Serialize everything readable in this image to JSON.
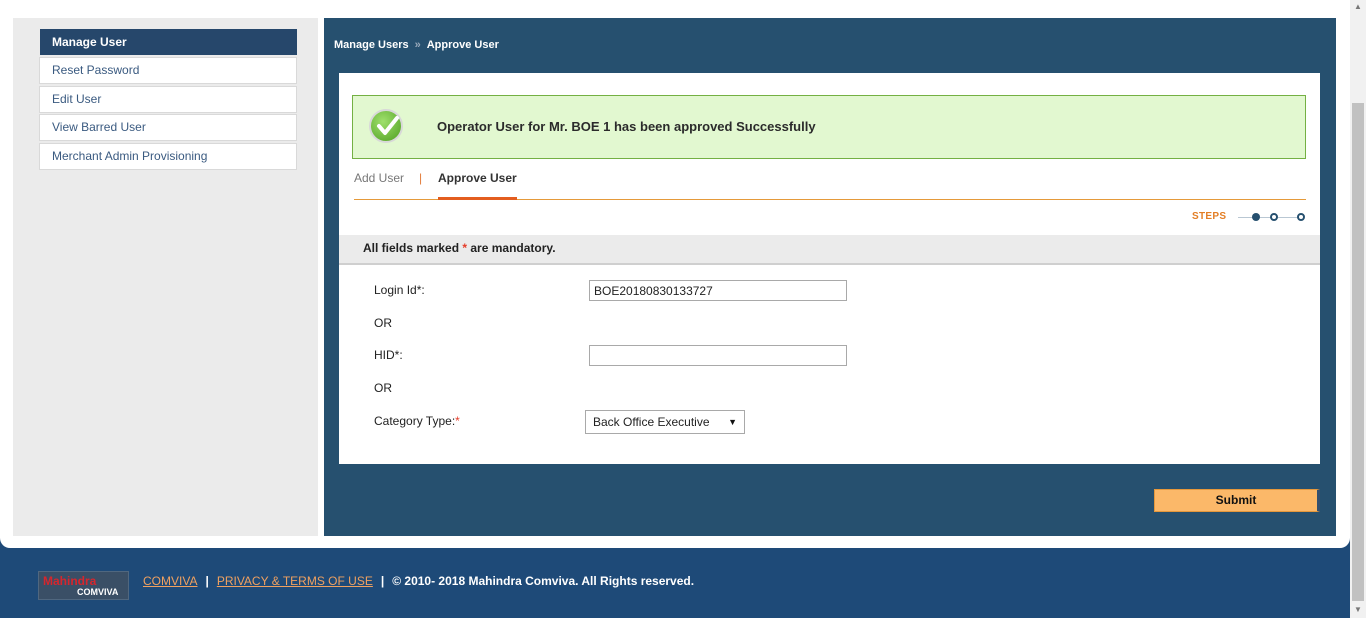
{
  "sidebar": {
    "header": "Manage User",
    "items": [
      {
        "label": "Reset Password"
      },
      {
        "label": "Edit User"
      },
      {
        "label": "View Barred User"
      },
      {
        "label": "Merchant Admin Provisioning"
      }
    ]
  },
  "breadcrumb": {
    "parent": "Manage Users",
    "separator": "»",
    "current": "Approve User"
  },
  "alert": {
    "message": "Operator User for Mr. BOE 1 has been approved Successfully",
    "icon": "check-icon"
  },
  "tabs": {
    "items": [
      {
        "label": "Add User"
      },
      {
        "label": "Approve User"
      }
    ],
    "separator": "|"
  },
  "steps": {
    "label": "STEPS",
    "count": 3,
    "current": 1
  },
  "form": {
    "mandatory_prefix": "All fields marked ",
    "mandatory_star": "*",
    "mandatory_suffix": " are mandatory.",
    "login_label": "Login Id*:",
    "login_value": "BOE20180830133727",
    "or1": "OR",
    "hid_label": "HID*:",
    "hid_value": "",
    "or2": "OR",
    "category_label": "Category Type:",
    "category_star": "*",
    "category_value": "Back Office Executive",
    "submit_label": "Submit"
  },
  "footer": {
    "logo_top": "Mahindra",
    "logo_bottom": "COMVIVA",
    "link1": "COMVIVA",
    "sep": "|",
    "link2": "PRIVACY & TERMS OF USE",
    "copyright": "© 2010- 2018  Mahindra Comviva. All Rights reserved."
  },
  "colors": {
    "header_bg": "#26476b",
    "panel_bg": "#26506f",
    "success_bg": "#e2f8d0",
    "accent_orange": "#e35d1f",
    "submit_bg": "#fbb869"
  }
}
